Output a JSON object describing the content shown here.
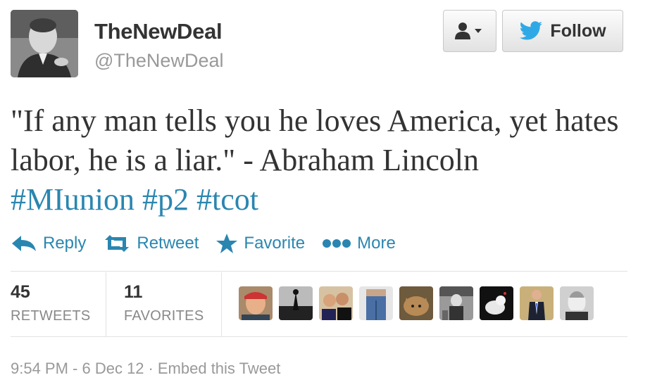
{
  "user": {
    "display_name": "TheNewDeal",
    "screen_name": "@TheNewDeal",
    "avatar_icon": "profile-photo"
  },
  "header": {
    "user_menu_icon": "user-dropdown-icon",
    "follow_label": "Follow"
  },
  "tweet": {
    "text": "\"If any man tells you he loves America, yet hates labor, he is a liar.\" - Abraham Lincoln",
    "hashtags": [
      "#MIunion",
      "#p2",
      "#tcot"
    ]
  },
  "actions": {
    "reply": "Reply",
    "retweet": "Retweet",
    "favorite": "Favorite",
    "more": "More"
  },
  "stats": {
    "retweets_count": "45",
    "retweets_label": "RETWEETS",
    "favorites_count": "11",
    "favorites_label": "FAVORITES"
  },
  "footer": {
    "timestamp": "9:54 PM - 6 Dec 12",
    "separator": "·",
    "embed_label": "Embed this Tweet"
  },
  "colors": {
    "link": "#2a86b0",
    "twitter_bird": "#2fa9e6"
  }
}
